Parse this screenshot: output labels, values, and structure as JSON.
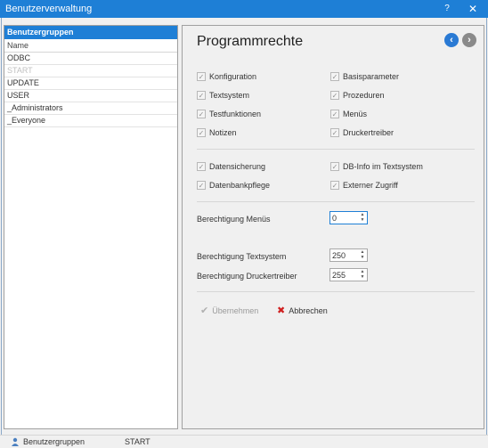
{
  "window": {
    "title": "Benutzerverwaltung",
    "help_label": "?",
    "close_label": "✕"
  },
  "left_panel": {
    "header": "Benutzergruppen",
    "column_header": "Name",
    "rows": [
      "ODBC",
      "START",
      "UPDATE",
      "USER",
      "_Administrators",
      "_Everyone"
    ]
  },
  "right_panel": {
    "title": "Programmrechte",
    "nav_back_icon": "arrow-left-circle-icon",
    "nav_forward_icon": "arrow-right-circle-icon",
    "checkboxes_group1": [
      {
        "label": "Konfiguration",
        "checked": true
      },
      {
        "label": "Basisparameter",
        "checked": true
      },
      {
        "label": "Textsystem",
        "checked": true
      },
      {
        "label": "Prozeduren",
        "checked": true
      },
      {
        "label": "Testfunktionen",
        "checked": true
      },
      {
        "label": "Menüs",
        "checked": true
      },
      {
        "label": "Notizen",
        "checked": true
      },
      {
        "label": "Druckertreiber",
        "checked": true
      }
    ],
    "checkboxes_group2": [
      {
        "label": "Datensicherung",
        "checked": true
      },
      {
        "label": "DB-Info im Textsystem",
        "checked": true
      },
      {
        "label": "Datenbankpflege",
        "checked": true
      },
      {
        "label": "Externer Zugriff",
        "checked": true
      }
    ],
    "fields": {
      "menus_label": "Berechtigung Menüs",
      "menus_value": "0",
      "textsystem_label": "Berechtigung Textsystem",
      "textsystem_value": "250",
      "druckertreiber_label": "Berechtigung Druckertreiber",
      "druckertreiber_value": "255"
    },
    "actions": {
      "apply_label": "Übernehmen",
      "cancel_label": "Abbrechen"
    }
  },
  "statusbar": {
    "groups_label": "Benutzergruppen",
    "current_label": "START"
  }
}
